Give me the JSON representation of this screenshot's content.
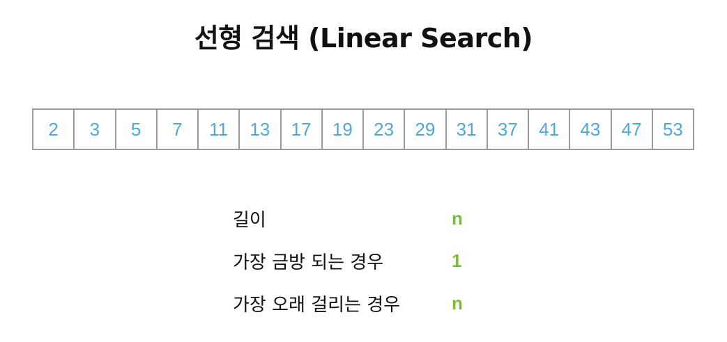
{
  "title": "선형 검색 (Linear Search)",
  "array": [
    "2",
    "3",
    "5",
    "7",
    "11",
    "13",
    "17",
    "19",
    "23",
    "29",
    "31",
    "37",
    "41",
    "43",
    "47",
    "53"
  ],
  "rows": [
    {
      "label": "길이",
      "value": "n"
    },
    {
      "label": "가장 금방 되는 경우",
      "value": "1"
    },
    {
      "label": "가장 오래 걸리는 경우",
      "value": "n"
    }
  ],
  "colors": {
    "array_text": "#4fa8d8",
    "cell_border": "#9a9a9a",
    "value_text": "#7dbb3c",
    "title_text": "#111111"
  }
}
